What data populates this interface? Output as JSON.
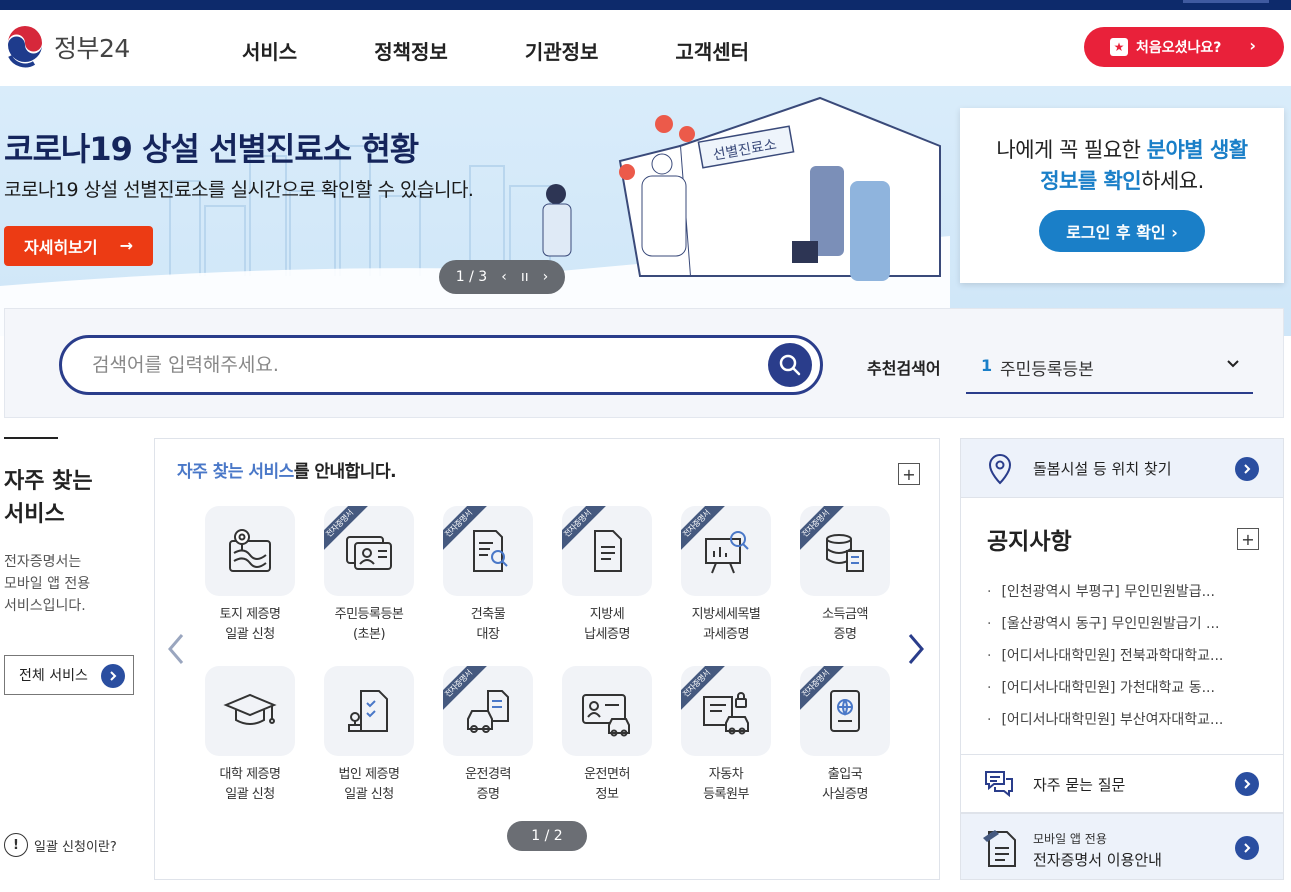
{
  "header": {
    "logo_text": "정부24",
    "nav": [
      "서비스",
      "정책정보",
      "기관정보",
      "고객센터"
    ],
    "first_visit_label": "처음오셨나요?"
  },
  "banner": {
    "title": "코로나19 상설 선별진료소 현황",
    "subtitle": "코로나19 상설 선별진료소를 실시간으로 확인할 수 있습니다.",
    "detail_label": "자세히보기",
    "pager": "1 / 3",
    "tent_sign": "선별진료소",
    "card": {
      "line1_pre": "나에게 꼭 필요한 ",
      "line1_hl": "분야별 생활",
      "line2_hl": "정보를 확인",
      "line2_post": "하세요.",
      "button_label": "로그인 후 확인 ›"
    }
  },
  "search": {
    "placeholder": "검색어를 입력해주세요.",
    "recommend_label": "추천검색어",
    "recommend_num": "1",
    "recommend_keyword": "주민등록등본"
  },
  "frequent": {
    "title_line1": "자주 찾는",
    "title_line2": "서비스",
    "desc": [
      "전자증명서는",
      "모바일 앱 전용",
      "서비스입니다."
    ],
    "all_label": "전체 서비스",
    "bulk_help": "일괄 신청이란?"
  },
  "services": {
    "head_hl": "자주 찾는 서비스",
    "head_rest": "를 안내합니다.",
    "ribbon_text": "전자증명서",
    "pager": "1 / 2",
    "items": [
      {
        "l1": "토지 제증명",
        "l2": "일괄 신청"
      },
      {
        "l1": "주민등록등본",
        "l2": "(초본)"
      },
      {
        "l1": "건축물",
        "l2": "대장"
      },
      {
        "l1": "지방세",
        "l2": "납세증명"
      },
      {
        "l1": "지방세세목별",
        "l2": "과세증명"
      },
      {
        "l1": "소득금액",
        "l2": "증명"
      },
      {
        "l1": "대학 제증명",
        "l2": "일괄 신청"
      },
      {
        "l1": "법인 제증명",
        "l2": "일괄 신청"
      },
      {
        "l1": "운전경력",
        "l2": "증명"
      },
      {
        "l1": "운전면허",
        "l2": "정보"
      },
      {
        "l1": "자동차",
        "l2": "등록원부"
      },
      {
        "l1": "출입국",
        "l2": "사실증명"
      }
    ]
  },
  "side": {
    "care_label": "돌봄시설 등 위치 찾기",
    "notice_title": "공지사항",
    "notices": [
      "[인천광역시 부평구] 무인민원발급...",
      "[울산광역시 동구] 무인민원발급기 ...",
      "[어디서나대학민원] 전북과학대학교...",
      "[어디서나대학민원] 가천대학교 동...",
      "[어디서나대학민원] 부산여자대학교..."
    ],
    "faq_label": "자주 묻는 질문",
    "mobile_small": "모바일 앱 전용",
    "mobile_label": "전자증명서 이용안내"
  },
  "colors": {
    "navy": "#2a3d8b",
    "red": "#e9213a",
    "orange": "#ec3b14",
    "blue": "#1a7fc8",
    "accent_blue": "#4a78c8"
  }
}
